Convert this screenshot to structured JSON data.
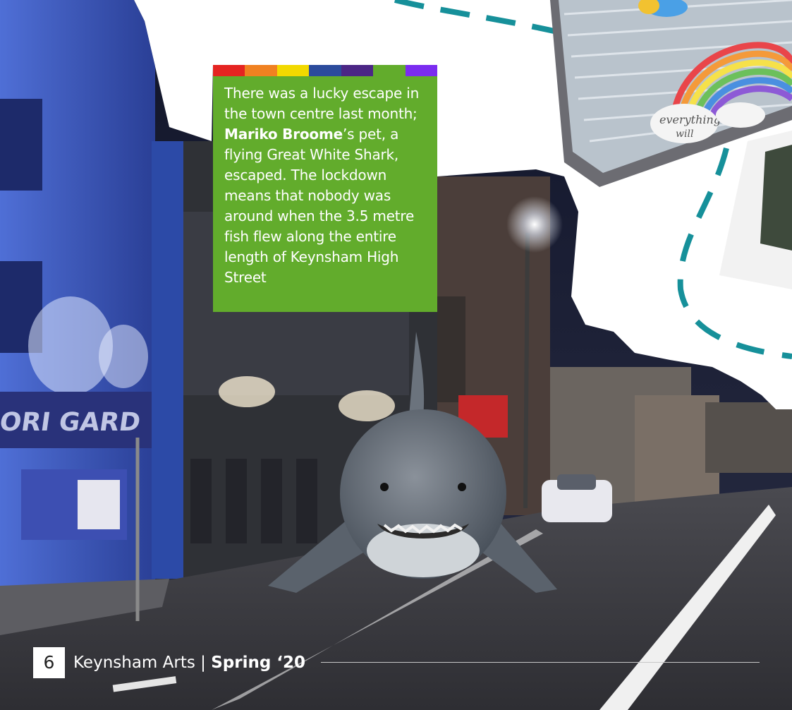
{
  "caption": {
    "text_before": "There was a lucky escape in the town centre last month; ",
    "name": "Mariko Broome",
    "text_after": "’s pet, a flying Great White Shark, escaped. The lockdown means that nobody was around when the 3.5 metre fish flew along the entire length of Keynsham High Street"
  },
  "rainbow_colors": [
    "#e52421",
    "#f08121",
    "#f2d900",
    "#2b4b9c",
    "#4b2685",
    "#62ac2c",
    "#7b2cf0"
  ],
  "window_sign": {
    "line1": "everything",
    "line2": "will"
  },
  "footer": {
    "page_number": "6",
    "publication": "Keynsham Arts | ",
    "season": "Spring ‘20"
  },
  "colors": {
    "accent_green": "#62ac2c",
    "dash_teal": "#16909a"
  }
}
